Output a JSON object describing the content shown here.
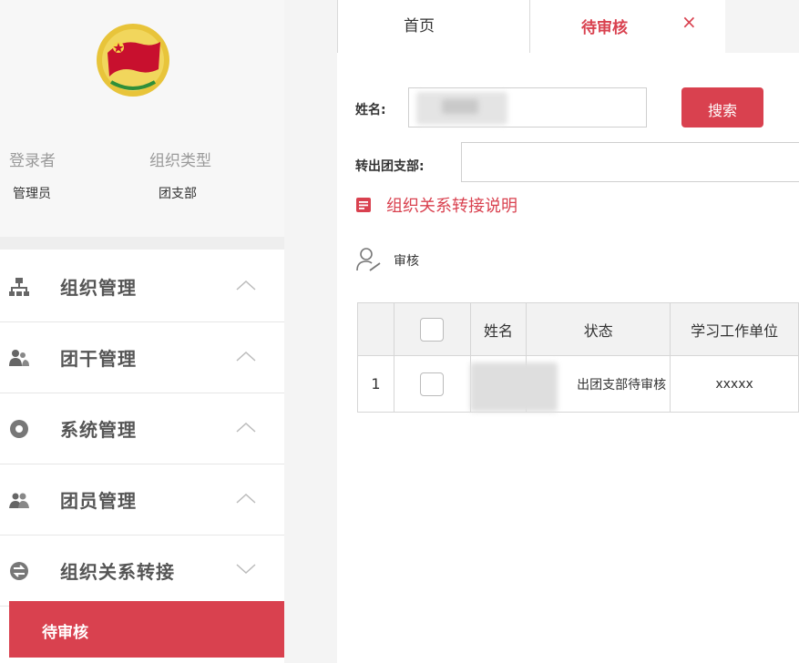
{
  "sidebar": {
    "profile": {
      "login_label": "登录者",
      "org_type_label": "组织类型",
      "login_value": "管理员",
      "org_type_value": "团支部"
    },
    "menu": [
      {
        "label": "组织管理",
        "icon": "org-chart-icon",
        "state": "collapsed"
      },
      {
        "label": "团干管理",
        "icon": "cadre-users-icon",
        "state": "collapsed"
      },
      {
        "label": "系统管理",
        "icon": "gear-icon",
        "state": "collapsed"
      },
      {
        "label": "团员管理",
        "icon": "members-icon",
        "state": "collapsed"
      },
      {
        "label": "组织关系转接",
        "icon": "transfer-icon",
        "state": "expanded"
      }
    ],
    "active_sub_item": "待审核"
  },
  "tabs": {
    "home": "首页",
    "active": "待审核",
    "close_glyph": "×"
  },
  "search": {
    "name_label": "姓名:",
    "branch_label": "转出团支部:",
    "button_label": "搜索"
  },
  "note_link": "组织关系转接说明",
  "audit_label": "审核",
  "table": {
    "headers": [
      "",
      "",
      "姓名",
      "状态",
      "学习工作单位"
    ],
    "rows": [
      {
        "index": "1",
        "status": "出团支部待审核",
        "unit": "xxxxx"
      }
    ]
  },
  "colors": {
    "accent": "#d9414f",
    "sidebar_profile_bg": "#f7f7f7",
    "tabbar_bg": "#f4f4f4"
  }
}
